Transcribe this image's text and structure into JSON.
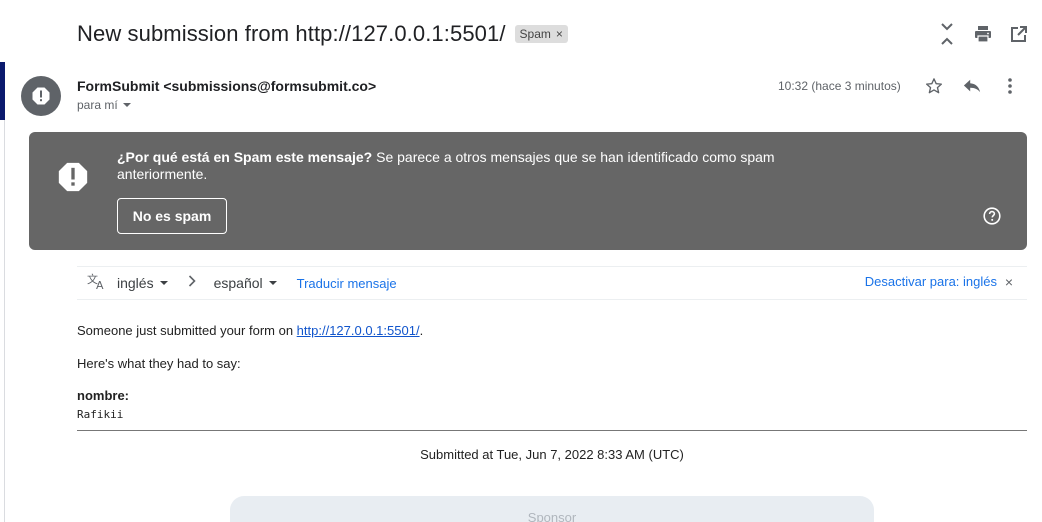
{
  "email": {
    "subject": "New submission from http://127.0.0.1:5501/",
    "label_chip": "Spam",
    "label_chip_close": "×",
    "sender": "FormSubmit <submissions@formsubmit.co>",
    "recipient_label": "para mí",
    "timestamp": "10:32 (hace 3 minutos)"
  },
  "top_actions": [
    "collapse-icon",
    "print-icon",
    "open-in-new-window-icon"
  ],
  "header_actions": [
    "star-icon",
    "reply-icon",
    "more-vert-icon"
  ],
  "spam_notice": {
    "title": "¿Por qué está en Spam este mensaje?",
    "text": " Se parece a otros mensajes que se han identificado como spam anteriormente.",
    "button_label": "No es spam",
    "background_color": "#666666"
  },
  "translate_bar": {
    "source_lang": "inglés",
    "target_lang": "español",
    "translate_link": "Traducir mensaje",
    "disable_link": "Desactivar para: inglés",
    "disable_close": "×"
  },
  "message": {
    "line1_prefix": "Someone just submitted your form on ",
    "line1_link": "http://127.0.0.1:5501/",
    "line1_suffix": ".",
    "line2": "Here's what they had to say:",
    "field_label": "nombre:",
    "field_value": "Rafikii",
    "submitted_at": "Submitted at Tue, Jun 7, 2022 8:33 AM (UTC)"
  },
  "sponsor_label": "Sponsor",
  "colors": {
    "link": "#1a73e8",
    "body_link": "#1155cc",
    "text": "#202124",
    "secondary": "#5f6368"
  }
}
